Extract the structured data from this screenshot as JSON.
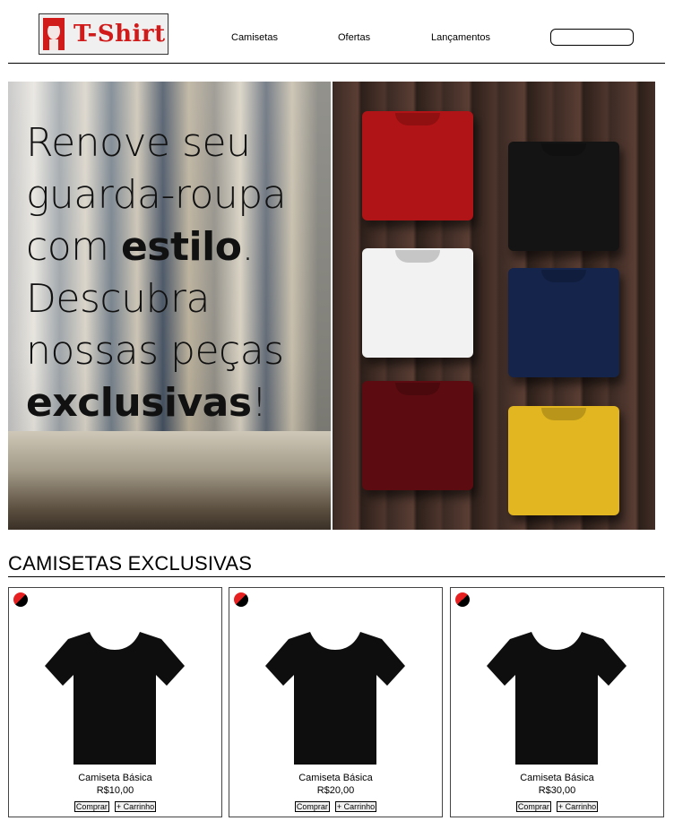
{
  "header": {
    "logo_text": "T-Shirt",
    "nav": [
      "Camisetas",
      "Ofertas",
      "Lançamentos"
    ],
    "search_placeholder": ""
  },
  "hero": {
    "line1": "Renove seu",
    "line2": "guarda-roupa",
    "line3_a": "com ",
    "line3_b": "estilo",
    "line3_c": ".",
    "line4": "Descubra",
    "line5": "nossas peças",
    "line6_b": "exclusivas",
    "line6_c": "!",
    "shirt_colors": [
      "#b01416",
      "#141414",
      "#f2f2f2",
      "#15244a",
      "#5c0c10",
      "#e2b620"
    ]
  },
  "section": {
    "title": "CAMISETAS EXCLUSIVAS"
  },
  "products": [
    {
      "name": "Camiseta Básica",
      "price": "R$10,00",
      "buy": "Comprar",
      "cart": "+ Carrinho"
    },
    {
      "name": "Camiseta Básica",
      "price": "R$20,00",
      "buy": "Comprar",
      "cart": "+ Carrinho"
    },
    {
      "name": "Camiseta Básica",
      "price": "R$30,00",
      "buy": "Comprar",
      "cart": "+ Carrinho"
    }
  ],
  "colors": {
    "brand_red": "#d11a1a",
    "badge_red": "#e62020",
    "shirt_black": "#0e0e0e"
  }
}
